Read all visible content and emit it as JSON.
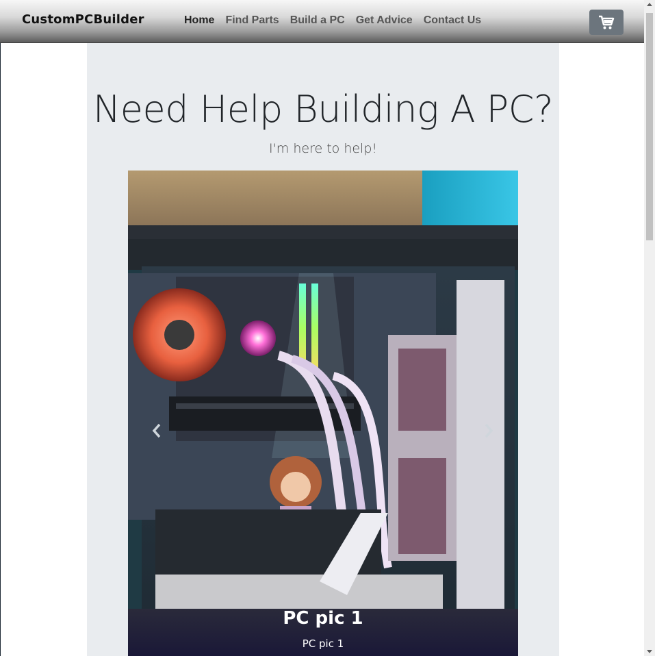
{
  "brand": "CustomPCBuilder",
  "nav": {
    "items": [
      {
        "label": "Home",
        "active": true
      },
      {
        "label": "Find Parts",
        "active": false
      },
      {
        "label": "Build a PC",
        "active": false
      },
      {
        "label": "Get Advice",
        "active": false
      },
      {
        "label": "Contact Us",
        "active": false
      }
    ],
    "cart_icon": "shopping-cart-icon"
  },
  "hero": {
    "title": "Need Help Building A PC?",
    "subtitle": "I'm here to help!"
  },
  "carousel": {
    "slide": {
      "title": "PC pic 1",
      "text": "PC pic 1"
    },
    "prev_icon": "chevron-left-icon",
    "next_icon": "chevron-right-icon"
  },
  "colors": {
    "jumbotron_bg": "#e9ecef",
    "cart_button": "#6c757d"
  }
}
